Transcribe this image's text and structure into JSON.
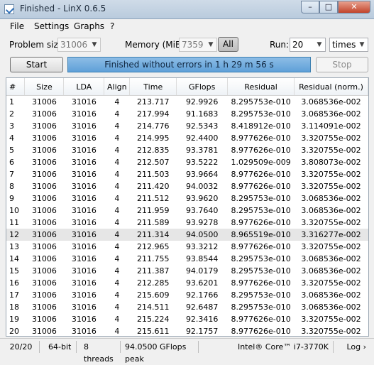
{
  "window": {
    "title": "Finished - LinX 0.6.5"
  },
  "menu": [
    "File",
    "Settings",
    "Graphs",
    "?"
  ],
  "controls": {
    "problem_size_label": "Problem size:",
    "problem_size_value": "31006",
    "memory_label": "Memory (MiB):",
    "memory_value": "7359",
    "all_label": "All",
    "run_label": "Run:",
    "run_value": "20",
    "times_value": "times",
    "start_label": "Start",
    "status_text": "Finished without errors in 1 h 29 m 56 s",
    "stop_label": "Stop"
  },
  "table": {
    "columns": [
      "#",
      "Size",
      "LDA",
      "Align",
      "Time",
      "GFlops",
      "Residual",
      "Residual (norm.)"
    ],
    "rows": [
      [
        "1",
        "31006",
        "31016",
        "4",
        "213.717",
        "92.9926",
        "8.295753e-010",
        "3.068536e-002"
      ],
      [
        "2",
        "31006",
        "31016",
        "4",
        "217.994",
        "91.1683",
        "8.295753e-010",
        "3.068536e-002"
      ],
      [
        "3",
        "31006",
        "31016",
        "4",
        "214.776",
        "92.5343",
        "8.418912e-010",
        "3.114091e-002"
      ],
      [
        "4",
        "31006",
        "31016",
        "4",
        "214.995",
        "92.4400",
        "8.977626e-010",
        "3.320755e-002"
      ],
      [
        "5",
        "31006",
        "31016",
        "4",
        "212.835",
        "93.3781",
        "8.977626e-010",
        "3.320755e-002"
      ],
      [
        "6",
        "31006",
        "31016",
        "4",
        "212.507",
        "93.5222",
        "1.029509e-009",
        "3.808073e-002"
      ],
      [
        "7",
        "31006",
        "31016",
        "4",
        "211.503",
        "93.9664",
        "8.977626e-010",
        "3.320755e-002"
      ],
      [
        "8",
        "31006",
        "31016",
        "4",
        "211.420",
        "94.0032",
        "8.977626e-010",
        "3.320755e-002"
      ],
      [
        "9",
        "31006",
        "31016",
        "4",
        "211.512",
        "93.9620",
        "8.295753e-010",
        "3.068536e-002"
      ],
      [
        "10",
        "31006",
        "31016",
        "4",
        "211.959",
        "93.7640",
        "8.295753e-010",
        "3.068536e-002"
      ],
      [
        "11",
        "31006",
        "31016",
        "4",
        "211.589",
        "93.9278",
        "8.977626e-010",
        "3.320755e-002"
      ],
      [
        "12",
        "31006",
        "31016",
        "4",
        "211.314",
        "94.0500",
        "8.965519e-010",
        "3.316277e-002"
      ],
      [
        "13",
        "31006",
        "31016",
        "4",
        "212.965",
        "93.3212",
        "8.977626e-010",
        "3.320755e-002"
      ],
      [
        "14",
        "31006",
        "31016",
        "4",
        "211.755",
        "93.8544",
        "8.295753e-010",
        "3.068536e-002"
      ],
      [
        "15",
        "31006",
        "31016",
        "4",
        "211.387",
        "94.0179",
        "8.295753e-010",
        "3.068536e-002"
      ],
      [
        "16",
        "31006",
        "31016",
        "4",
        "212.285",
        "93.6201",
        "8.977626e-010",
        "3.320755e-002"
      ],
      [
        "17",
        "31006",
        "31016",
        "4",
        "215.609",
        "92.1766",
        "8.295753e-010",
        "3.068536e-002"
      ],
      [
        "18",
        "31006",
        "31016",
        "4",
        "214.511",
        "92.6487",
        "8.295753e-010",
        "3.068536e-002"
      ],
      [
        "19",
        "31006",
        "31016",
        "4",
        "215.224",
        "92.3416",
        "8.977626e-010",
        "3.320755e-002"
      ],
      [
        "20",
        "31006",
        "31016",
        "4",
        "215.611",
        "92.1757",
        "8.977626e-010",
        "3.320755e-002"
      ]
    ],
    "selected_row": 11
  },
  "statusbar": {
    "progress": "20/20",
    "bits": "64-bit",
    "threads": "8 threads",
    "peak": "94.0500 GFlops peak",
    "cpu": "Intel® Core™ i7-3770K",
    "log": "Log ›"
  }
}
